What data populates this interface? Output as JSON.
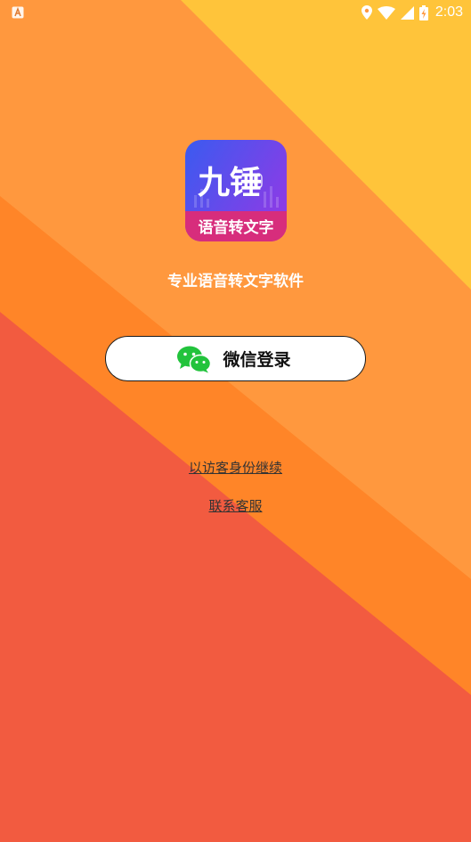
{
  "status_bar": {
    "time": "2:03",
    "left_icon": "a-notification-icon",
    "icons": [
      "location-icon",
      "wifi-icon",
      "signal-icon",
      "battery-charging-icon"
    ]
  },
  "app": {
    "logo_main_text": "九锤",
    "logo_sub_text": "语音转文字",
    "slogan": "专业语音转文字软件"
  },
  "login": {
    "wechat_button_label": "微信登录"
  },
  "links": {
    "guest": "以访客身份继续",
    "contact_support": "联系客服"
  },
  "colors": {
    "bg_yellow": "#ffc43a",
    "bg_orange_light": "#ff983e",
    "bg_orange": "#ff8528",
    "bg_red": "#f25b40",
    "logo_blue": "#3a5bf0",
    "logo_purple": "#8a3ce6",
    "logo_pink": "#d72d7c",
    "wechat_green": "#22c33c"
  }
}
